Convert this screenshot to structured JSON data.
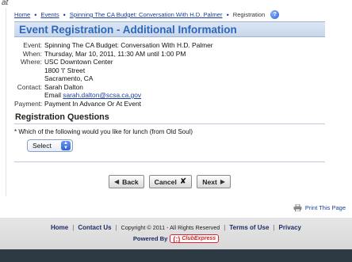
{
  "corner_mark": "at",
  "breadcrumb": {
    "items": [
      "Home",
      "Events",
      "Spinning The CA Budget: Conversation With H.D. Palmer"
    ],
    "current": "Registration"
  },
  "page_title": "Event Registration - Additional Information",
  "details": {
    "event_label": "Event:",
    "event_value": "Spinning The CA Budget: Conversation With H.D. Palmer",
    "when_label": "When:",
    "when_value": "Thursday, Mar 10, 2011, 11:30 AM until 1:00 PM",
    "where_label": "Where:",
    "where_lines": [
      "USC Downtown Center",
      "1800 'I' Street",
      "Sacramento, CA"
    ],
    "contact_label": "Contact:",
    "contact_name": "Sarah Dalton",
    "email_prefix": "Email",
    "contact_email": "sarah.dalton@scsa.ca.gov",
    "payment_label": "Payment:",
    "payment_value": "Payment In Advance Or At Event"
  },
  "questions": {
    "heading": "Registration Questions",
    "question_1": "* Which of the following would you like for lunch (from Old Soul)",
    "select_value": "Select"
  },
  "buttons": {
    "back": "Back",
    "cancel": "Cancel",
    "next": "Next"
  },
  "print_link": "Print This Page",
  "footer": {
    "home": "Home",
    "contact": "Contact Us",
    "copyright": "Copyright © 2011 - All Rights Reserved",
    "terms": "Terms of Use",
    "privacy": "Privacy",
    "powered_by": "Powered By",
    "logo_text": "ClubExpress"
  },
  "colors": {
    "link": "#1a3f9c",
    "title": "#2f67b8",
    "title_bar_bg": "#c7d6ec",
    "footer_bg": "#d2d2d2",
    "footer_link": "#1e2c63",
    "bottom_band": "#2d3a44"
  }
}
